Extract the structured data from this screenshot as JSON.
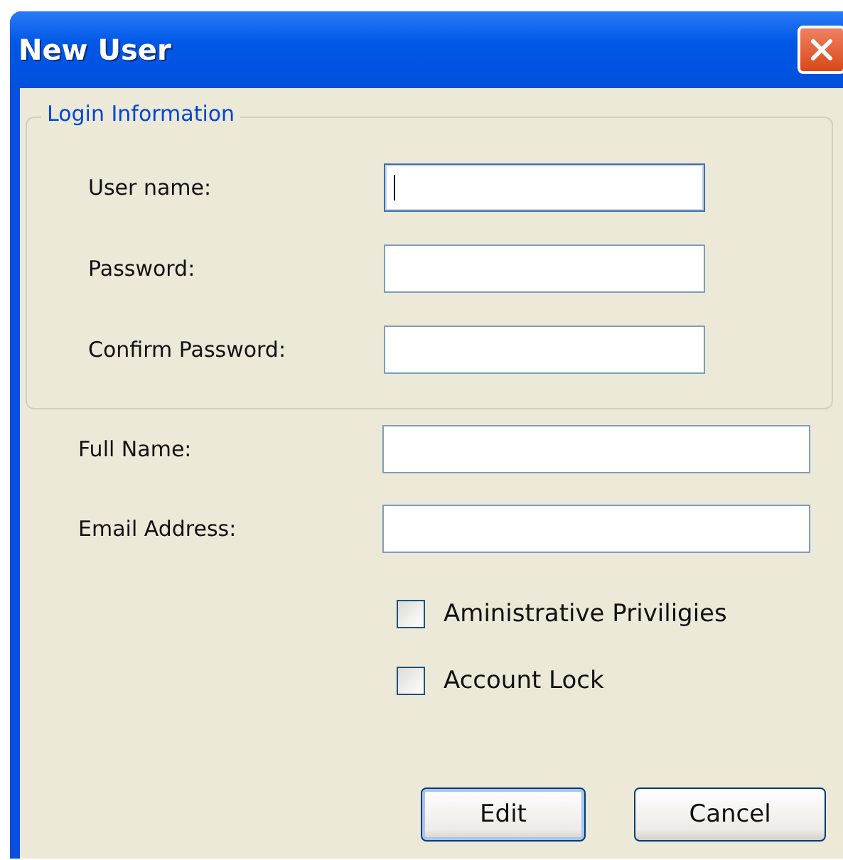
{
  "window": {
    "title": "New User"
  },
  "login_group": {
    "title": "Login Information",
    "fields": [
      {
        "label": "User name:",
        "focused": true
      },
      {
        "label": "Password:",
        "focused": false
      },
      {
        "label": "Confirm Password:",
        "focused": false
      }
    ]
  },
  "fields": [
    {
      "label": "Full Name:",
      "focused": false
    },
    {
      "label": "Email Address:",
      "focused": false
    }
  ],
  "checkboxes": [
    {
      "label": "Aministrative Priviligies",
      "checked": false
    },
    {
      "label": "Account Lock",
      "checked": false
    }
  ],
  "buttons": [
    {
      "label": "Edit",
      "default": true
    },
    {
      "label": "Cancel",
      "default": false
    }
  ]
}
